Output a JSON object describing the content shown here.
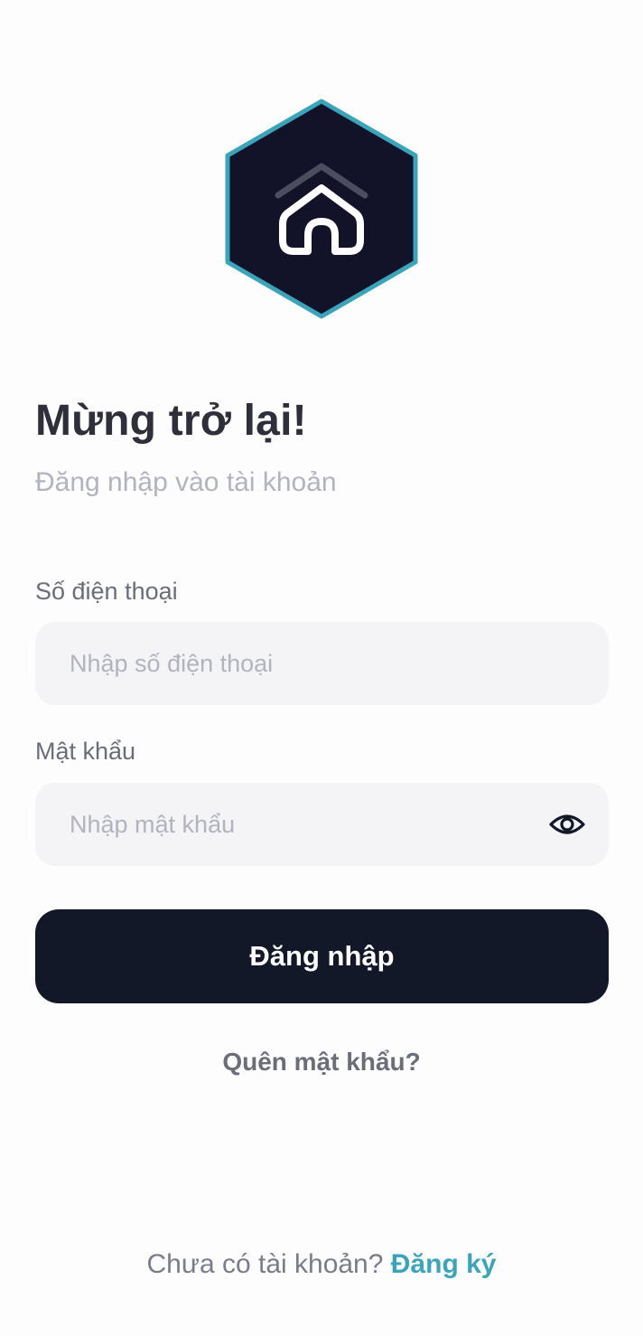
{
  "brand": {
    "logo_icon": "house-hexagon-icon",
    "hex_fill": "#121228",
    "hex_border": "#3AA5BA"
  },
  "header": {
    "title": "Mừng trở lại!",
    "subtitle": "Đăng nhập vào tài khoản"
  },
  "form": {
    "phone": {
      "label": "Số điện thoại",
      "placeholder": "Nhập số điện thoại",
      "value": ""
    },
    "password": {
      "label": "Mật khẩu",
      "placeholder": "Nhập mật khẩu",
      "value": "",
      "toggle_icon": "eye-icon"
    },
    "submit_label": "Đăng nhập",
    "forgot_label": "Quên mật khẩu?"
  },
  "footer": {
    "prompt": "Chưa có tài khoản?",
    "register_label": "Đăng ký"
  },
  "colors": {
    "primary": "#131828",
    "accent": "#3AA5BA",
    "background": "#FDFDFE",
    "input_bg": "#F4F4F7"
  }
}
